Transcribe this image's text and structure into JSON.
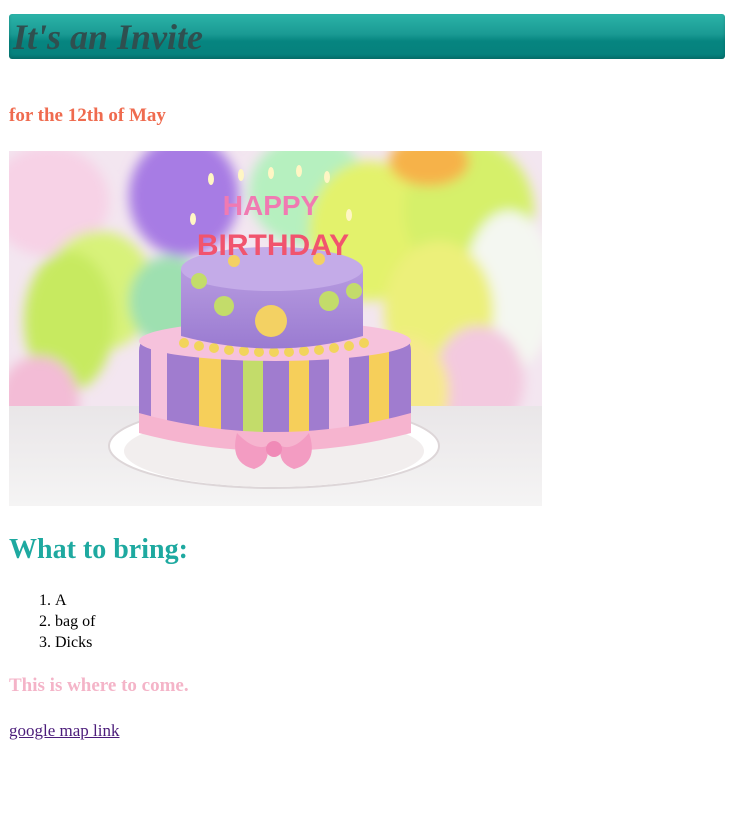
{
  "header": {
    "title": "It's an Invite"
  },
  "date_text": "for the 12th of May",
  "image": {
    "cake_text_line1": "HAPPY",
    "cake_text_line2": "BIRTHDAY"
  },
  "bring": {
    "title": "What to bring:",
    "items": [
      "A",
      "bag of",
      "Dicks"
    ]
  },
  "where_text": "This is where to come.",
  "map_link": {
    "label": "google map link"
  },
  "colors": {
    "title_bar": "#068580",
    "title_text": "#2f4f4f",
    "date": "#ef6b4f",
    "section_title": "#1ea9a0",
    "where": "#f4b4c8",
    "link": "#4b1c7a"
  }
}
